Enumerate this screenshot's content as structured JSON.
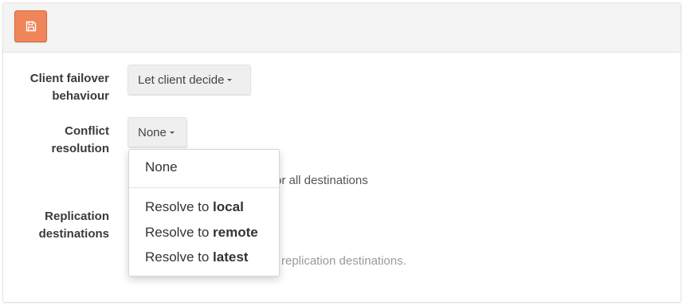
{
  "toolbar": {
    "save_icon": "floppy-disk-icon"
  },
  "client_failover": {
    "label_line1": "Client failover",
    "label_line2": "behaviour",
    "selected": "Let client decide"
  },
  "conflict_resolution": {
    "label_line1": "Conflict",
    "label_line2": "resolution",
    "selected": "None",
    "hint": "or all destinations",
    "menu": {
      "none": "None",
      "items": [
        {
          "prefix": "Resolve to ",
          "bold": "local"
        },
        {
          "prefix": "Resolve to ",
          "bold": "remote"
        },
        {
          "prefix": "Resolve to ",
          "bold": "latest"
        }
      ]
    }
  },
  "replication_destinations": {
    "label_line1": "Replication",
    "label_line2": "destinations",
    "hint": "replication destinations."
  },
  "colors": {
    "save_button": "#f0855b",
    "toolbar_bg": "#f4f4f4"
  }
}
